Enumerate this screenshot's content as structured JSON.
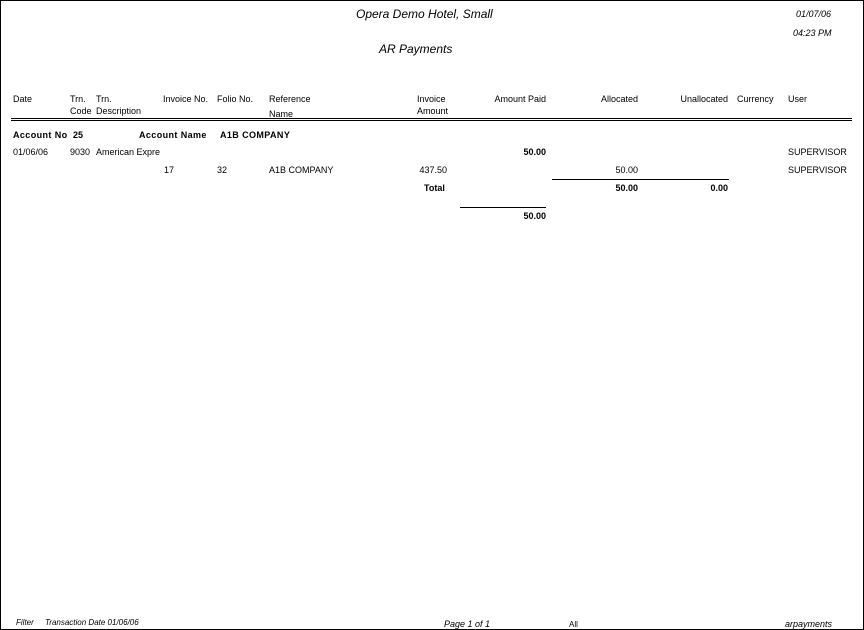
{
  "report": {
    "hotel": "Opera Demo Hotel, Small",
    "date": "01/07/06",
    "time": "04:23 PM",
    "title": "AR Payments"
  },
  "columns": {
    "date": "Date",
    "trn_code_1": "Trn.",
    "trn_code_2": "Code",
    "trn_desc_1": "Trn.",
    "trn_desc_2": "Description",
    "invoice_no": "Invoice No.",
    "folio_no": "Folio No.",
    "reference_1": "Reference",
    "reference_2": "Name",
    "invoice_amount_1": "Invoice",
    "invoice_amount_2": "Amount",
    "amount_paid": "Amount Paid",
    "allocated": "Allocated",
    "unallocated": "Unallocated",
    "currency": "Currency",
    "user": "User"
  },
  "account": {
    "no_label": "Account No",
    "no": "25",
    "name_label": "Account Name",
    "name": "A1B COMPANY"
  },
  "payment_row": {
    "date": "01/06/06",
    "code": "9030",
    "description": "American Expre",
    "amount_paid": "50.00",
    "user": "SUPERVISOR"
  },
  "allocation_row": {
    "invoice_no": "17",
    "folio_no": "32",
    "reference": "A1B COMPANY",
    "invoice_amount": "437.50",
    "allocated": "50.00",
    "user": "SUPERVISOR"
  },
  "totals": {
    "label": "Total",
    "allocated": "50.00",
    "unallocated": "0.00",
    "grand_amount_paid": "50.00"
  },
  "footer": {
    "filter_label": "Filter",
    "filter_value": "Transaction Date 01/06/06",
    "page": "Page 1 of 1",
    "scope": "All",
    "report_name": "arpayments"
  }
}
